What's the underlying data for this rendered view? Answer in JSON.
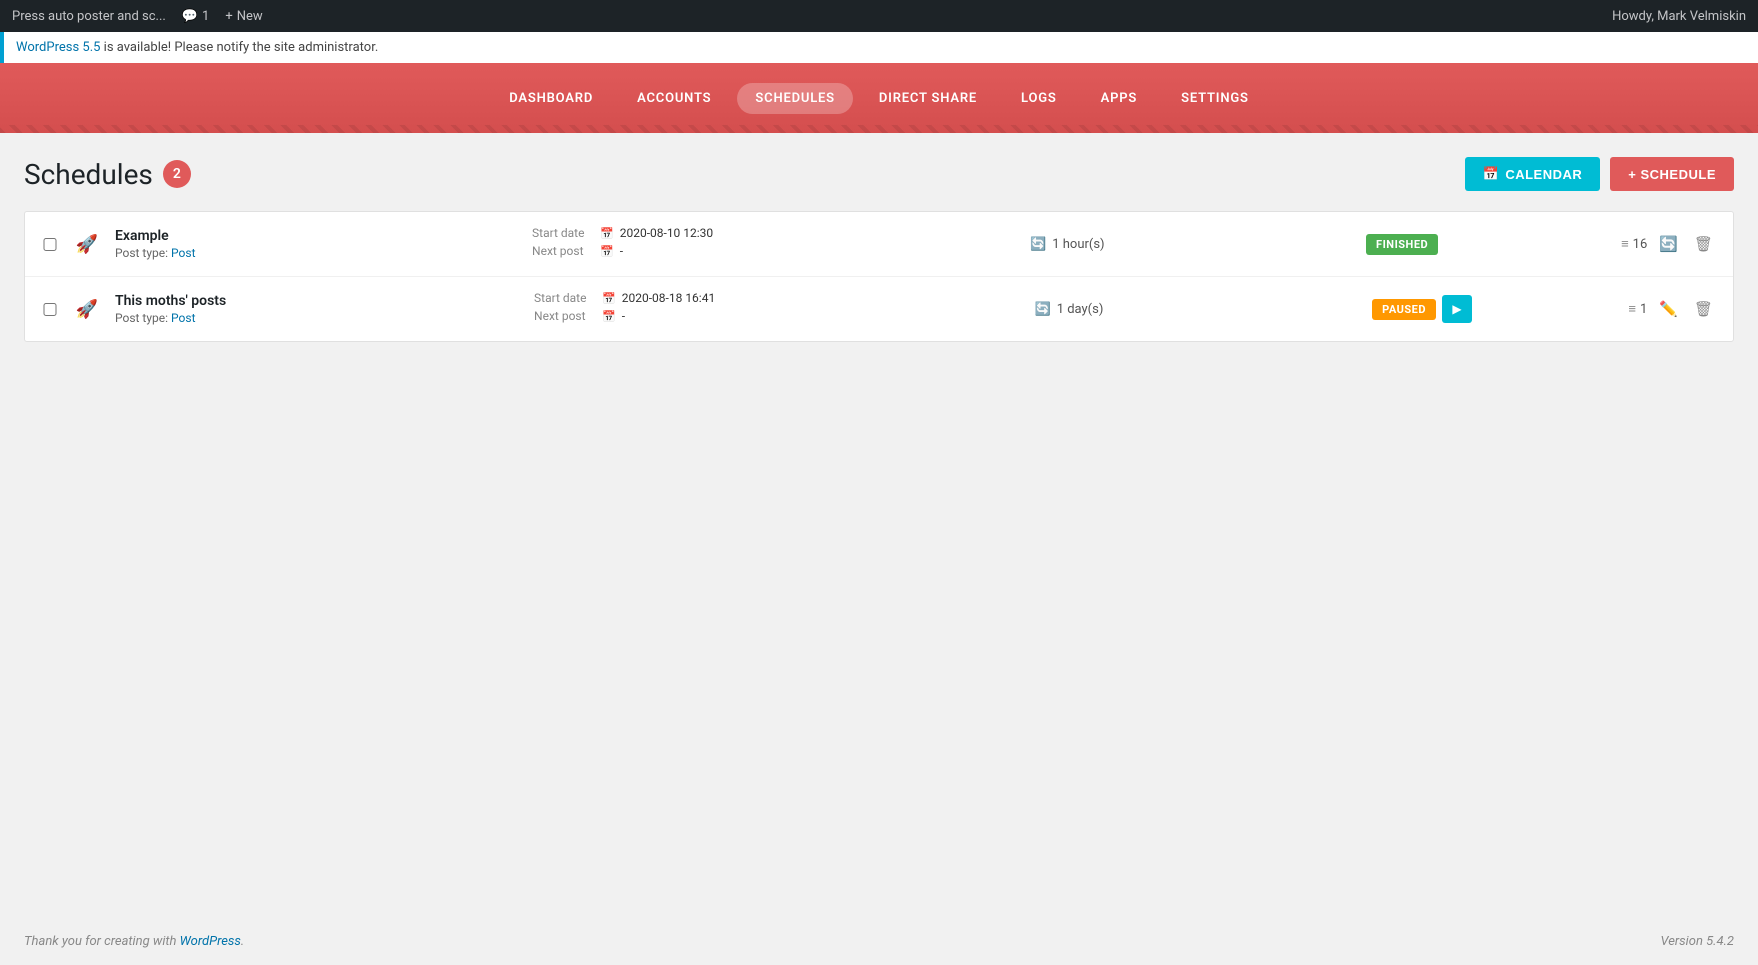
{
  "adminbar": {
    "site_name": "Press auto poster and sc...",
    "comments_label": "1",
    "new_label": "New",
    "user_greeting": "Howdy, Mark Velmiskin"
  },
  "notice": {
    "link_text": "WordPress 5.5",
    "message": " is available! Please notify the site administrator."
  },
  "nav": {
    "items": [
      {
        "id": "dashboard",
        "label": "DASHBOARD",
        "active": false
      },
      {
        "id": "accounts",
        "label": "ACCOUNTS",
        "active": false
      },
      {
        "id": "schedules",
        "label": "SCHEDULES",
        "active": true
      },
      {
        "id": "direct-share",
        "label": "DIRECT SHARE",
        "active": false
      },
      {
        "id": "logs",
        "label": "LOGS",
        "active": false
      },
      {
        "id": "apps",
        "label": "APPS",
        "active": false
      },
      {
        "id": "settings",
        "label": "SETTINGS",
        "active": false
      }
    ]
  },
  "page": {
    "title": "Schedules",
    "count": "2",
    "calendar_btn": "CALENDAR",
    "schedule_btn": "+ SCHEDULE"
  },
  "schedules": [
    {
      "id": "example",
      "name": "Example",
      "post_type_label": "Post type:",
      "post_type_link": "Post",
      "start_date_label": "Start date",
      "start_date": "2020-08-10 12:30",
      "next_post_label": "Next post",
      "next_post": "-",
      "interval": "1 hour(s)",
      "status": "FINISHED",
      "status_type": "finished",
      "list_count": "16",
      "has_play": false
    },
    {
      "id": "this-moths-posts",
      "name": "This moths' posts",
      "post_type_label": "Post type:",
      "post_type_link": "Post",
      "start_date_label": "Start date",
      "start_date": "2020-08-18 16:41",
      "next_post_label": "Next post",
      "next_post": "-",
      "interval": "1 day(s)",
      "status": "PAUSED",
      "status_type": "paused",
      "list_count": "1",
      "has_play": true
    }
  ],
  "footer": {
    "thank_you": "Thank you for creating with ",
    "wp_link": "WordPress",
    "version": "Version 5.4.2"
  },
  "colors": {
    "accent_red": "#e05a5a",
    "accent_teal": "#00bcd4",
    "finished_green": "#4caf50",
    "paused_orange": "#ff9800"
  }
}
